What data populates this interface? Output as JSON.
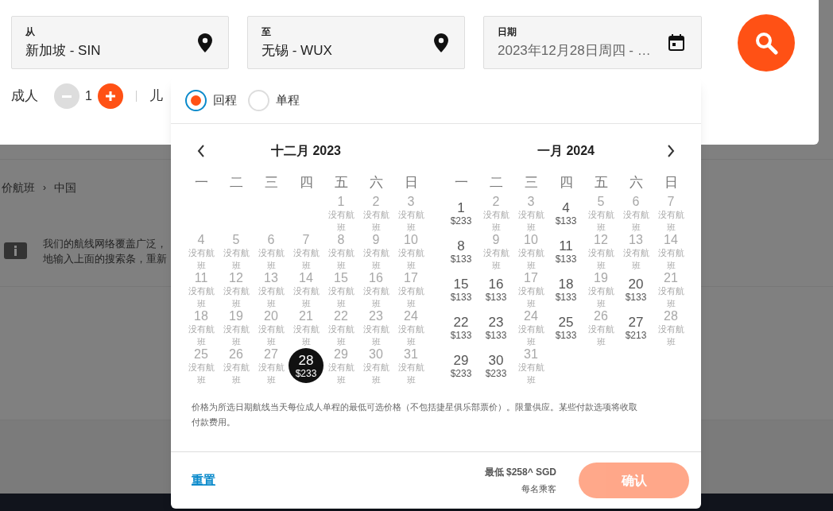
{
  "search_form": {
    "fields": [
      {
        "label": "从",
        "value": "新加坡 - SIN",
        "kind": "place"
      },
      {
        "label": "至",
        "value": "无锡 - WUX",
        "kind": "place"
      },
      {
        "label": "日期",
        "value": "2023年12月28日周四 - …",
        "kind": "date"
      }
    ],
    "passengers": [
      {
        "label": "成人",
        "count": "1",
        "minus_disabled": true
      },
      {
        "label": "儿"
      }
    ]
  },
  "page": {
    "breadcrumb": [
      "价航班",
      "中国"
    ],
    "breadcrumb_separator": "›",
    "info_lines": [
      "我们的航线网络覆盖广泛，",
      "地输入上面的搜索条，重新"
    ]
  },
  "date_picker": {
    "trip_types": [
      {
        "label": "回程",
        "selected": true
      },
      {
        "label": "单程",
        "selected": false
      }
    ],
    "months": [
      {
        "title": "十二月 2023",
        "weekdays": [
          "一",
          "二",
          "三",
          "四",
          "五",
          "六",
          "日"
        ],
        "days": [
          {
            "kind": "blank"
          },
          {
            "kind": "blank"
          },
          {
            "kind": "blank"
          },
          {
            "kind": "blank"
          },
          {
            "kind": "none",
            "day": "1",
            "note": "没有航班",
            "selected": false
          },
          {
            "kind": "none",
            "day": "2",
            "note": "没有航班",
            "selected": false
          },
          {
            "kind": "none",
            "day": "3",
            "note": "没有航班",
            "selected": false
          },
          {
            "kind": "none",
            "day": "4",
            "note": "没有航班",
            "selected": false
          },
          {
            "kind": "none",
            "day": "5",
            "note": "没有航班",
            "selected": false
          },
          {
            "kind": "none",
            "day": "6",
            "note": "没有航班",
            "selected": false
          },
          {
            "kind": "none",
            "day": "7",
            "note": "没有航班",
            "selected": false
          },
          {
            "kind": "none",
            "day": "8",
            "note": "没有航班",
            "selected": false
          },
          {
            "kind": "none",
            "day": "9",
            "note": "没有航班",
            "selected": false
          },
          {
            "kind": "none",
            "day": "10",
            "note": "没有航班",
            "selected": false
          },
          {
            "kind": "none",
            "day": "11",
            "note": "没有航班",
            "selected": false
          },
          {
            "kind": "none",
            "day": "12",
            "note": "没有航班",
            "selected": false
          },
          {
            "kind": "none",
            "day": "13",
            "note": "没有航班",
            "selected": false
          },
          {
            "kind": "none",
            "day": "14",
            "note": "没有航班",
            "selected": false
          },
          {
            "kind": "none",
            "day": "15",
            "note": "没有航班",
            "selected": false
          },
          {
            "kind": "none",
            "day": "16",
            "note": "没有航班",
            "selected": false
          },
          {
            "kind": "none",
            "day": "17",
            "note": "没有航班",
            "selected": false
          },
          {
            "kind": "none",
            "day": "18",
            "note": "没有航班",
            "selected": false
          },
          {
            "kind": "none",
            "day": "19",
            "note": "没有航班",
            "selected": false
          },
          {
            "kind": "none",
            "day": "20",
            "note": "没有航班",
            "selected": false
          },
          {
            "kind": "none",
            "day": "21",
            "note": "没有航班",
            "selected": false
          },
          {
            "kind": "none",
            "day": "22",
            "note": "没有航班",
            "selected": false
          },
          {
            "kind": "none",
            "day": "23",
            "note": "没有航班",
            "selected": false
          },
          {
            "kind": "none",
            "day": "24",
            "note": "没有航班",
            "selected": false
          },
          {
            "kind": "none",
            "day": "25",
            "note": "没有航班",
            "selected": false
          },
          {
            "kind": "none",
            "day": "26",
            "note": "没有航班",
            "selected": false
          },
          {
            "kind": "none",
            "day": "27",
            "note": "没有航班",
            "selected": false
          },
          {
            "kind": "price",
            "day": "28",
            "price": "$233",
            "selected": true
          },
          {
            "kind": "none",
            "day": "29",
            "note": "没有航班",
            "selected": false
          },
          {
            "kind": "none",
            "day": "30",
            "note": "没有航班",
            "selected": false
          },
          {
            "kind": "none",
            "day": "31",
            "note": "没有航班",
            "selected": false
          }
        ]
      },
      {
        "title": "一月 2024",
        "weekdays": [
          "一",
          "二",
          "三",
          "四",
          "五",
          "六",
          "日"
        ],
        "days": [
          {
            "kind": "price",
            "day": "1",
            "price": "$233",
            "selected": false
          },
          {
            "kind": "none",
            "day": "2",
            "note": "没有航班",
            "selected": false
          },
          {
            "kind": "none",
            "day": "3",
            "note": "没有航班",
            "selected": false
          },
          {
            "kind": "price",
            "day": "4",
            "price": "$133",
            "selected": false
          },
          {
            "kind": "none",
            "day": "5",
            "note": "没有航班",
            "selected": false
          },
          {
            "kind": "none",
            "day": "6",
            "note": "没有航班",
            "selected": false
          },
          {
            "kind": "none",
            "day": "7",
            "note": "没有航班",
            "selected": false
          },
          {
            "kind": "price",
            "day": "8",
            "price": "$133",
            "selected": false
          },
          {
            "kind": "none",
            "day": "9",
            "note": "没有航班",
            "selected": false
          },
          {
            "kind": "none",
            "day": "10",
            "note": "没有航班",
            "selected": false
          },
          {
            "kind": "price",
            "day": "11",
            "price": "$133",
            "selected": false
          },
          {
            "kind": "none",
            "day": "12",
            "note": "没有航班",
            "selected": false
          },
          {
            "kind": "none",
            "day": "13",
            "note": "没有航班",
            "selected": false
          },
          {
            "kind": "none",
            "day": "14",
            "note": "没有航班",
            "selected": false
          },
          {
            "kind": "price",
            "day": "15",
            "price": "$133",
            "selected": false
          },
          {
            "kind": "price",
            "day": "16",
            "price": "$133",
            "selected": false
          },
          {
            "kind": "none",
            "day": "17",
            "note": "没有航班",
            "selected": false
          },
          {
            "kind": "price",
            "day": "18",
            "price": "$133",
            "selected": false
          },
          {
            "kind": "none",
            "day": "19",
            "note": "没有航班",
            "selected": false
          },
          {
            "kind": "price",
            "day": "20",
            "price": "$133",
            "selected": false
          },
          {
            "kind": "none",
            "day": "21",
            "note": "没有航班",
            "selected": false
          },
          {
            "kind": "price",
            "day": "22",
            "price": "$133",
            "selected": false
          },
          {
            "kind": "price",
            "day": "23",
            "price": "$133",
            "selected": false
          },
          {
            "kind": "none",
            "day": "24",
            "note": "没有航班",
            "selected": false
          },
          {
            "kind": "price",
            "day": "25",
            "price": "$133",
            "selected": false
          },
          {
            "kind": "none",
            "day": "26",
            "note": "没有航班",
            "selected": false
          },
          {
            "kind": "price",
            "day": "27",
            "price": "$213",
            "selected": false
          },
          {
            "kind": "none",
            "day": "28",
            "note": "没有航班",
            "selected": false
          },
          {
            "kind": "price",
            "day": "29",
            "price": "$233",
            "selected": false
          },
          {
            "kind": "price",
            "day": "30",
            "price": "$233",
            "selected": false
          },
          {
            "kind": "none",
            "day": "31",
            "note": "没有航班",
            "selected": false
          }
        ]
      }
    ],
    "note": "价格为所选日期航线当天每位成人单程的最低可选价格（不包括捷星俱乐部票价）。限量供应。某些付款选项将收取付款费用。",
    "reset": "重置",
    "lowest": "最低 $258^ SGD",
    "per_passenger": "每名乘客",
    "confirm": {
      "label": "确认",
      "disabled": true
    }
  }
}
